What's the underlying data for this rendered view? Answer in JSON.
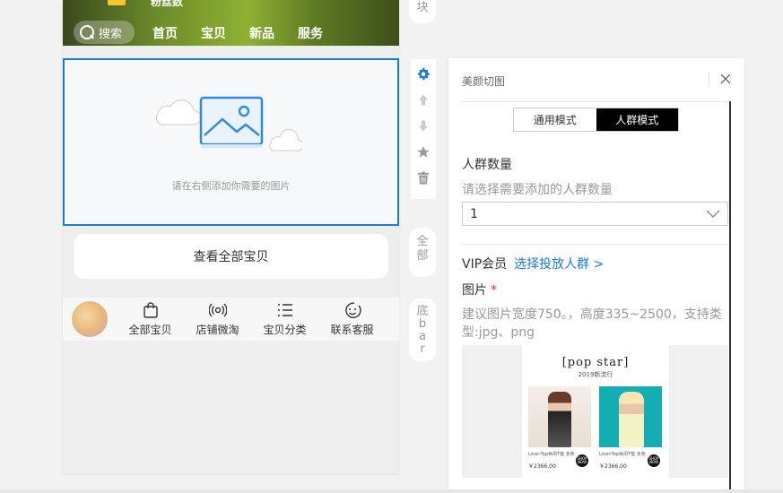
{
  "banner": {
    "fans_label": "粉丝数",
    "search_label": "搜索",
    "nav": [
      "首页",
      "宝贝",
      "新品",
      "服务"
    ]
  },
  "image_module": {
    "hint": "请在右侧添加你需要的图片"
  },
  "view_all_label": "查看全部宝贝",
  "bottom_bar": {
    "items": [
      {
        "label": "全部宝贝",
        "icon": "shopping-bag-icon"
      },
      {
        "label": "店铺微淘",
        "icon": "broadcast-icon"
      },
      {
        "label": "宝贝分类",
        "icon": "list-icon"
      },
      {
        "label": "联系客服",
        "icon": "smile-icon"
      }
    ]
  },
  "side_tags": {
    "top": "块",
    "all": [
      "全",
      "部"
    ],
    "bottom": [
      "底",
      "b",
      "a",
      "r"
    ]
  },
  "tools": [
    "gear-icon",
    "arrow-up-icon",
    "arrow-down-icon",
    "star-icon",
    "trash-icon"
  ],
  "panel": {
    "title": "美颜切图",
    "modes": {
      "general": "通用模式",
      "crowd": "人群模式",
      "active": "crowd"
    },
    "crowd_count_label": "人群数量",
    "crowd_count_hint": "请选择需要添加的人群数量",
    "crowd_count_value": "1",
    "vip_label": "VIP会员",
    "vip_link": "选择投放人群 >",
    "image_label": "图片",
    "required_mark": "*",
    "image_hint_1": "建议图片宽度750。，高度335~2500，支持类",
    "image_hint_2": "型:jpg、png",
    "poster": {
      "title": "[pop star]",
      "subtitle": "2019新流行",
      "caption": "Liner-Top休闲T恤 多色",
      "price": "￥2366.00",
      "shop": "SHOP NOW"
    }
  },
  "colors": {
    "accent": "#1a7ad9",
    "required": "#e62e2e",
    "active_tab": "#000000"
  }
}
